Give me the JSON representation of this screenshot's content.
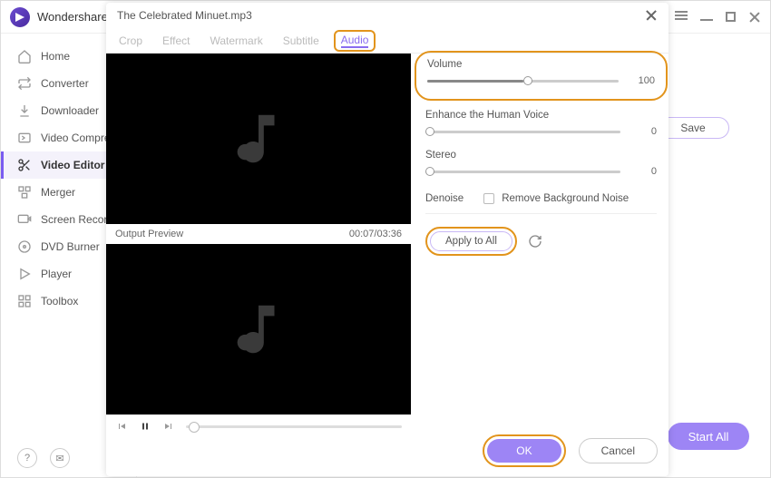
{
  "app": {
    "title": "Wondershare"
  },
  "sidebar": {
    "items": [
      {
        "label": "Home"
      },
      {
        "label": "Converter"
      },
      {
        "label": "Downloader"
      },
      {
        "label": "Video Compressor"
      },
      {
        "label": "Video Editor"
      },
      {
        "label": "Merger"
      },
      {
        "label": "Screen Recorder"
      },
      {
        "label": "DVD Burner"
      },
      {
        "label": "Player"
      },
      {
        "label": "Toolbox"
      }
    ]
  },
  "bg": {
    "save": "Save",
    "start_all": "Start All"
  },
  "dialog": {
    "title": "The Celebrated Minuet.mp3",
    "tabs": {
      "crop": "Crop",
      "effect": "Effect",
      "watermark": "Watermark",
      "subtitle": "Subtitle",
      "audio": "Audio"
    },
    "preview": {
      "output_label": "Output Preview",
      "time": "00:07/03:36"
    },
    "settings": {
      "volume": {
        "label": "Volume",
        "value": "100",
        "percent": 50
      },
      "enhance": {
        "label": "Enhance the Human Voice",
        "value": "0",
        "percent": 0
      },
      "stereo": {
        "label": "Stereo",
        "value": "0",
        "percent": 0
      },
      "denoise": {
        "label": "Denoise",
        "checkbox_label": "Remove Background Noise"
      },
      "apply_all": "Apply to All"
    },
    "footer": {
      "ok": "OK",
      "cancel": "Cancel"
    }
  }
}
